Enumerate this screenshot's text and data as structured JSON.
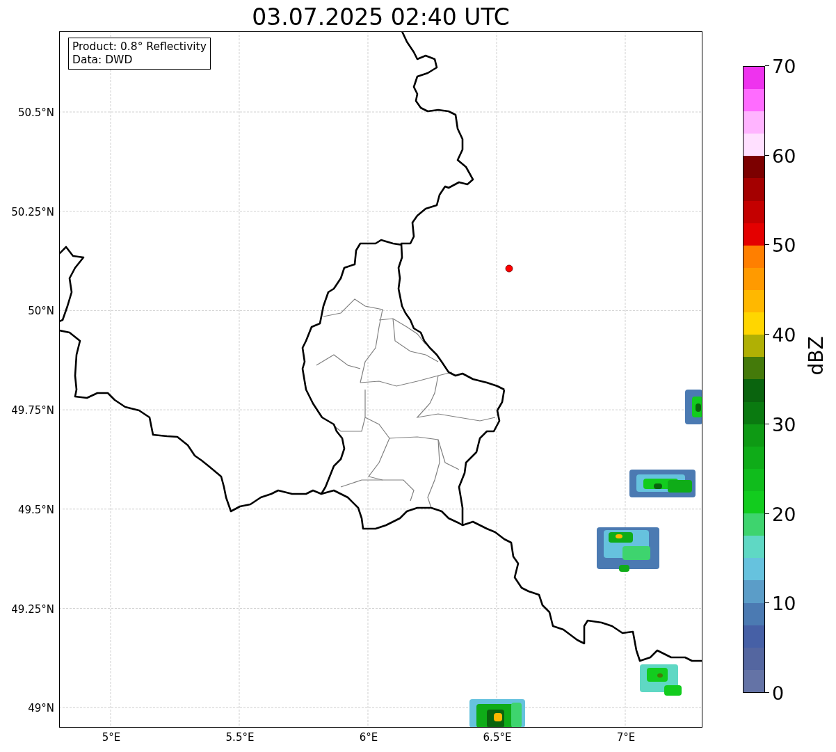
{
  "title": "03.07.2025 02:40 UTC",
  "info_box": [
    "Product: 0.8° Reflectivity",
    "Data: DWD"
  ],
  "x_ticks": [
    "5°E",
    "5.5°E",
    "6°E",
    "6.5°E",
    "7°E"
  ],
  "y_ticks": [
    "50.5°N",
    "50.25°N",
    "50°N",
    "49.75°N",
    "49.5°N",
    "49.25°N",
    "49°N"
  ],
  "colorbar": {
    "label": "dBZ",
    "ticks": [
      "70",
      "60",
      "50",
      "40",
      "30",
      "20",
      "10",
      "0"
    ],
    "bins": [
      {
        "color": "#6473a6"
      },
      {
        "color": "#5466a0"
      },
      {
        "color": "#4660a6"
      },
      {
        "color": "#4b7ab2"
      },
      {
        "color": "#5b9dc8"
      },
      {
        "color": "#66c2de"
      },
      {
        "color": "#5fd8c4"
      },
      {
        "color": "#3ed46e"
      },
      {
        "color": "#12cc1e"
      },
      {
        "color": "#10bc1c"
      },
      {
        "color": "#0fac18"
      },
      {
        "color": "#0e9a14"
      },
      {
        "color": "#0a7a10"
      },
      {
        "color": "#0a640e"
      },
      {
        "color": "#447a0a"
      },
      {
        "color": "#b0b004"
      },
      {
        "color": "#ffd600"
      },
      {
        "color": "#ffb800"
      },
      {
        "color": "#ff9a00"
      },
      {
        "color": "#ff7f00"
      },
      {
        "color": "#e40000"
      },
      {
        "color": "#c40000"
      },
      {
        "color": "#a40000"
      },
      {
        "color": "#7c0000"
      },
      {
        "color": "#ffe0ff"
      },
      {
        "color": "#ffb4ff"
      },
      {
        "color": "#ff6cff"
      },
      {
        "color": "#ee33ee"
      }
    ]
  }
}
